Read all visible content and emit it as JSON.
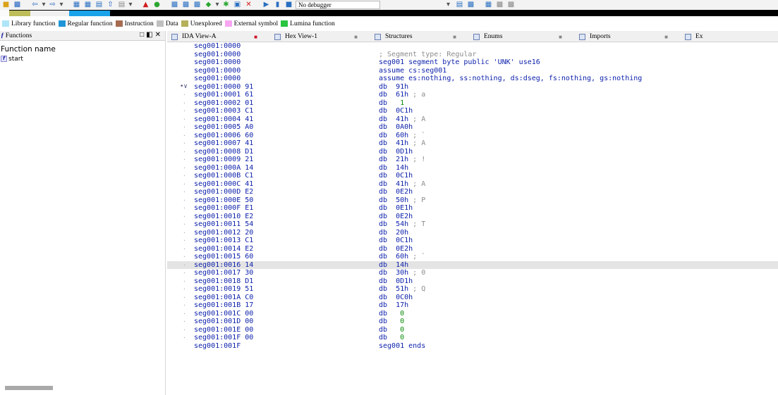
{
  "toolbar": {
    "debugger_label": "No debugger",
    "icons": [
      "open-icon",
      "save-icon",
      "back-icon",
      "forward-icon",
      "graph-icon",
      "jump-icon",
      "up-icon",
      "list-icon",
      "bookmark-icon",
      "warning-icon",
      "run-icon",
      "segment-icon",
      "code-icon",
      "data-icon",
      "stop-icon",
      "play-icon",
      "pause-icon",
      "stop-square-icon",
      "attach-icon",
      "settings-icon"
    ]
  },
  "legend": [
    {
      "label": "Library function",
      "color": "#aee5f8"
    },
    {
      "label": "Regular function",
      "color": "#1f95d8"
    },
    {
      "label": "Instruction",
      "color": "#a66b50"
    },
    {
      "label": "Data",
      "color": "#c0c0c0"
    },
    {
      "label": "Unexplored",
      "color": "#b5b05a"
    },
    {
      "label": "External symbol",
      "color": "#f8a6f3"
    },
    {
      "label": "Lumina function",
      "color": "#29c440"
    }
  ],
  "functions_panel": {
    "title": "Functions",
    "column_header": "Function name",
    "items": [
      "start"
    ]
  },
  "tabs": [
    {
      "label": "IDA View-A",
      "active": true
    },
    {
      "label": "Hex View-1",
      "active": false
    },
    {
      "label": "Structures",
      "active": false
    },
    {
      "label": "Enums",
      "active": false
    },
    {
      "label": "Imports",
      "active": false
    },
    {
      "label": "Ex",
      "active": false
    }
  ],
  "listing": {
    "header_rows": [
      {
        "addr": "seg001:0000",
        "text": ""
      },
      {
        "addr": "seg001:0000",
        "text": "; Segment type: Regular"
      },
      {
        "addr": "seg001:0000",
        "text": "seg001 segment byte public 'UNK' use16"
      },
      {
        "addr": "seg001:0000",
        "text": "assume cs:seg001"
      },
      {
        "addr": "seg001:0000",
        "text": "assume es:nothing, ss:nothing, ds:dseg, fs:nothing, gs:nothing"
      }
    ],
    "rows": [
      {
        "addr": "seg001:0000",
        "byte": "91",
        "instr": "db",
        "value": "91h",
        "comment": ""
      },
      {
        "addr": "seg001:0001",
        "byte": "61",
        "instr": "db",
        "value": "61h",
        "comment": "; a"
      },
      {
        "addr": "seg001:0002",
        "byte": "01",
        "instr": "db",
        "value": "1",
        "comment": ""
      },
      {
        "addr": "seg001:0003",
        "byte": "C1",
        "instr": "db",
        "value": "0C1h",
        "comment": ""
      },
      {
        "addr": "seg001:0004",
        "byte": "41",
        "instr": "db",
        "value": "41h",
        "comment": "; A"
      },
      {
        "addr": "seg001:0005",
        "byte": "A0",
        "instr": "db",
        "value": "0A0h",
        "comment": ""
      },
      {
        "addr": "seg001:0006",
        "byte": "60",
        "instr": "db",
        "value": "60h",
        "comment": "; `"
      },
      {
        "addr": "seg001:0007",
        "byte": "41",
        "instr": "db",
        "value": "41h",
        "comment": "; A"
      },
      {
        "addr": "seg001:0008",
        "byte": "D1",
        "instr": "db",
        "value": "0D1h",
        "comment": ""
      },
      {
        "addr": "seg001:0009",
        "byte": "21",
        "instr": "db",
        "value": "21h",
        "comment": "; !"
      },
      {
        "addr": "seg001:000A",
        "byte": "14",
        "instr": "db",
        "value": "14h",
        "comment": ""
      },
      {
        "addr": "seg001:000B",
        "byte": "C1",
        "instr": "db",
        "value": "0C1h",
        "comment": ""
      },
      {
        "addr": "seg001:000C",
        "byte": "41",
        "instr": "db",
        "value": "41h",
        "comment": "; A"
      },
      {
        "addr": "seg001:000D",
        "byte": "E2",
        "instr": "db",
        "value": "0E2h",
        "comment": ""
      },
      {
        "addr": "seg001:000E",
        "byte": "50",
        "instr": "db",
        "value": "50h",
        "comment": "; P"
      },
      {
        "addr": "seg001:000F",
        "byte": "E1",
        "instr": "db",
        "value": "0E1h",
        "comment": ""
      },
      {
        "addr": "seg001:0010",
        "byte": "E2",
        "instr": "db",
        "value": "0E2h",
        "comment": ""
      },
      {
        "addr": "seg001:0011",
        "byte": "54",
        "instr": "db",
        "value": "54h",
        "comment": "; T"
      },
      {
        "addr": "seg001:0012",
        "byte": "20",
        "instr": "db",
        "value": "20h",
        "comment": ""
      },
      {
        "addr": "seg001:0013",
        "byte": "C1",
        "instr": "db",
        "value": "0C1h",
        "comment": ""
      },
      {
        "addr": "seg001:0014",
        "byte": "E2",
        "instr": "db",
        "value": "0E2h",
        "comment": ""
      },
      {
        "addr": "seg001:0015",
        "byte": "60",
        "instr": "db",
        "value": "60h",
        "comment": "; `"
      },
      {
        "addr": "seg001:0016",
        "byte": "14",
        "instr": "db",
        "value": "14h",
        "comment": "",
        "highlight": true
      },
      {
        "addr": "seg001:0017",
        "byte": "30",
        "instr": "db",
        "value": "30h",
        "comment": "; 0"
      },
      {
        "addr": "seg001:0018",
        "byte": "D1",
        "instr": "db",
        "value": "0D1h",
        "comment": ""
      },
      {
        "addr": "seg001:0019",
        "byte": "51",
        "instr": "db",
        "value": "51h",
        "comment": "; Q"
      },
      {
        "addr": "seg001:001A",
        "byte": "C0",
        "instr": "db",
        "value": "0C0h",
        "comment": ""
      },
      {
        "addr": "seg001:001B",
        "byte": "17",
        "instr": "db",
        "value": "17h",
        "comment": ""
      },
      {
        "addr": "seg001:001C",
        "byte": "00",
        "instr": "db",
        "value": "0",
        "comment": ""
      },
      {
        "addr": "seg001:001D",
        "byte": "00",
        "instr": "db",
        "value": "0",
        "comment": ""
      },
      {
        "addr": "seg001:001E",
        "byte": "00",
        "instr": "db",
        "value": "0",
        "comment": ""
      },
      {
        "addr": "seg001:001F",
        "byte": "00",
        "instr": "db",
        "value": "0",
        "comment": ""
      }
    ],
    "footer_rows": [
      {
        "addr": "seg001:001F",
        "text": "seg001 ends"
      }
    ]
  }
}
